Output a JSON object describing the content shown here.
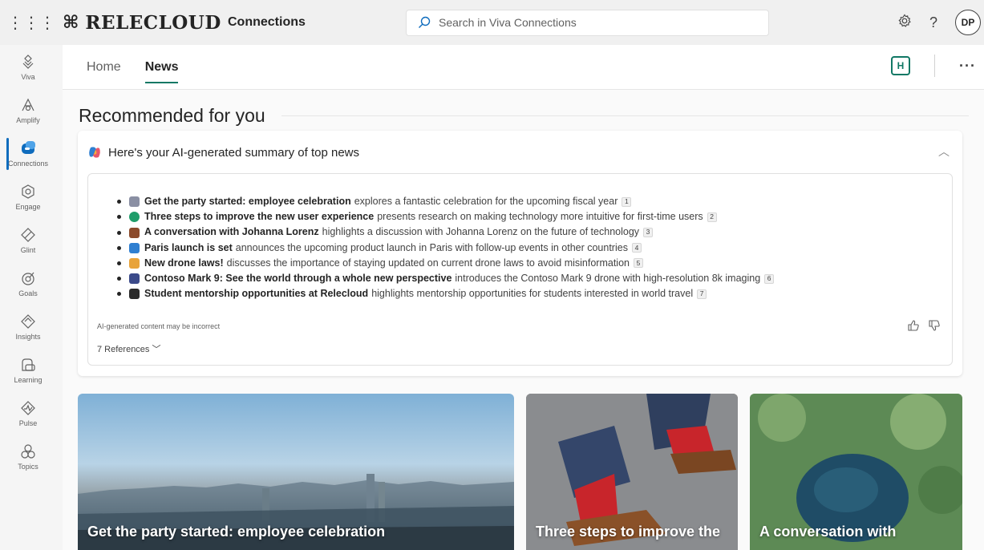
{
  "topbar": {
    "brand": "RELECLOUD",
    "app_name": "Connections",
    "search_placeholder": "Search in Viva Connections",
    "avatar_initials": "DP",
    "help_label": "?"
  },
  "rail": {
    "items": [
      {
        "label": "Viva",
        "icon": "viva-icon"
      },
      {
        "label": "Amplify",
        "icon": "amplify-icon"
      },
      {
        "label": "Connections",
        "icon": "connections-icon",
        "active": true
      },
      {
        "label": "Engage",
        "icon": "engage-icon"
      },
      {
        "label": "Glint",
        "icon": "glint-icon"
      },
      {
        "label": "Goals",
        "icon": "goals-icon"
      },
      {
        "label": "Insights",
        "icon": "insights-icon"
      },
      {
        "label": "Learning",
        "icon": "learning-icon"
      },
      {
        "label": "Pulse",
        "icon": "pulse-icon"
      },
      {
        "label": "Topics",
        "icon": "topics-icon"
      }
    ]
  },
  "tabs": [
    {
      "label": "Home",
      "active": false
    },
    {
      "label": "News",
      "active": true
    }
  ],
  "tabs_right": {
    "badge": "H",
    "more": "···"
  },
  "main": {
    "section_title": "Recommended for you",
    "summary": {
      "title": "Here's your AI-generated summary of top news",
      "items": [
        {
          "bold": "Get the party started: employee celebration",
          "text": "explores a fantastic celebration for the upcoming fiscal year",
          "ref": "1",
          "color": "#8a8fa3"
        },
        {
          "bold": "Three steps to improve the new user experience",
          "text": "presents research on making technology more intuitive for first-time users",
          "ref": "2",
          "color": "#1f9d6a"
        },
        {
          "bold": "A conversation with Johanna Lorenz",
          "text": "highlights a discussion with Johanna Lorenz on the future of technology",
          "ref": "3",
          "color": "#8b4a2b"
        },
        {
          "bold": "Paris launch is set",
          "text": "announces the upcoming product launch in Paris with follow-up events in other countries",
          "ref": "4",
          "color": "#2f7fd1"
        },
        {
          "bold": "New drone laws!",
          "text": "discusses the importance of staying updated on current drone laws to avoid misinformation",
          "ref": "5",
          "color": "#e8a33a"
        },
        {
          "bold": "Contoso Mark 9: See the world through a whole new perspective",
          "text": "introduces the Contoso Mark 9 drone with high-resolution 8k imaging",
          "ref": "6",
          "color": "#3b4a8a"
        },
        {
          "bold": "Student mentorship opportunities at Relecloud",
          "text": "highlights mentorship opportunities for students interested in world travel",
          "ref": "7",
          "color": "#2b2b2b"
        }
      ],
      "disclaimer": "AI-generated content may be incorrect",
      "references": "7 References"
    },
    "news": [
      {
        "title": "Get the party started: employee celebration"
      },
      {
        "title": "Three steps to improve the"
      },
      {
        "title": "A conversation with"
      }
    ]
  },
  "colors": {
    "accent": "#117865",
    "brand_blue": "#0f6cbd"
  }
}
